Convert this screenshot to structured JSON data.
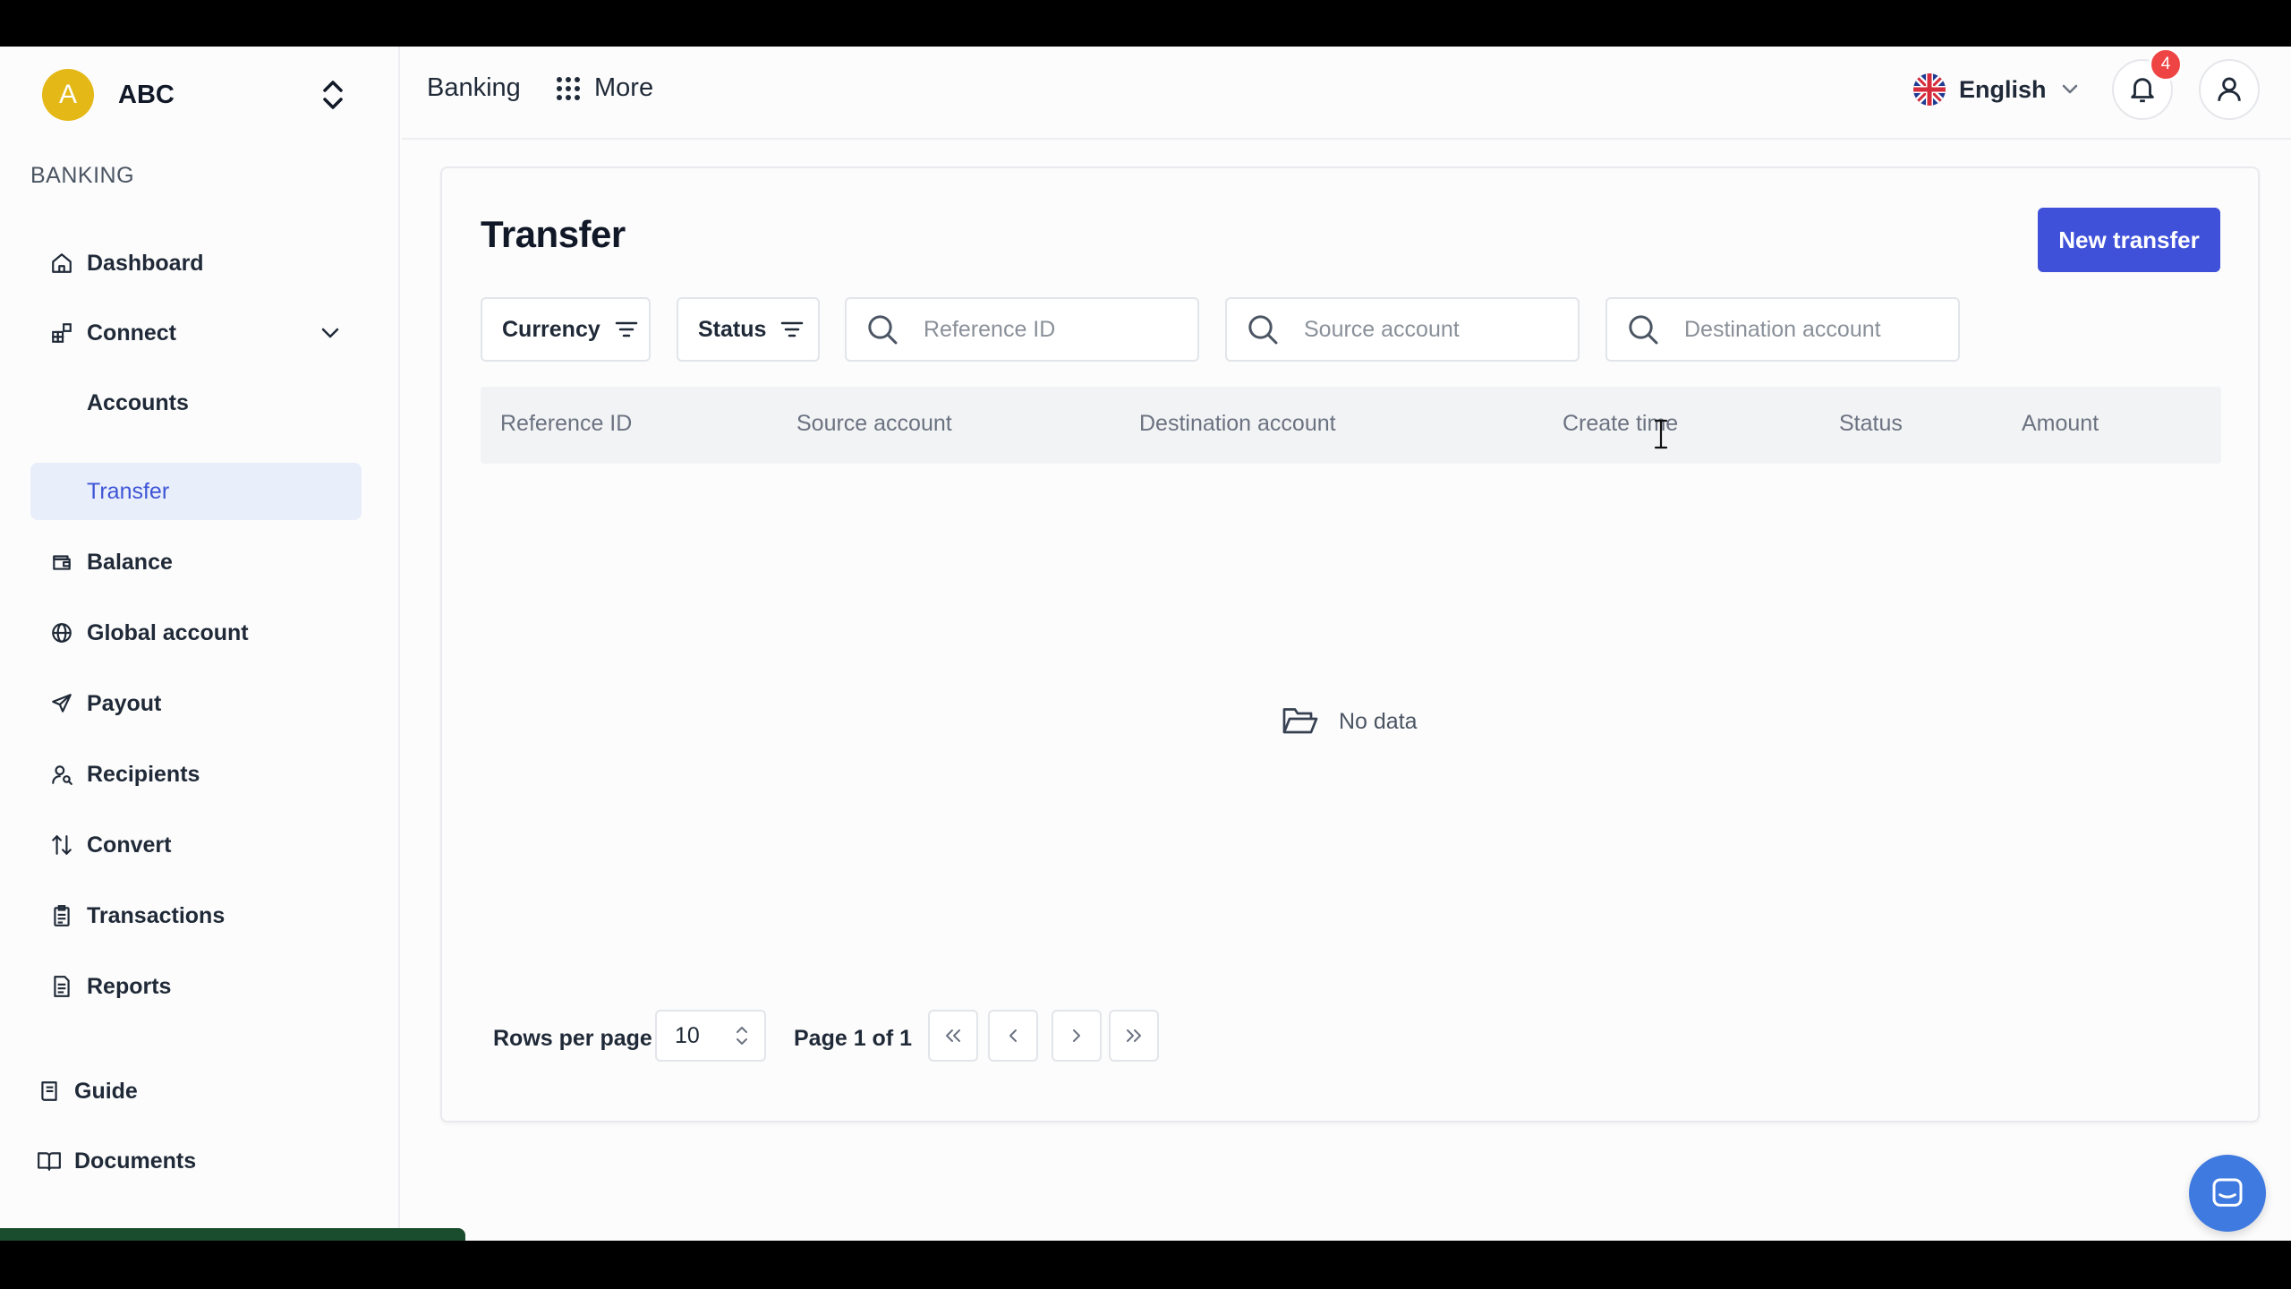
{
  "org": {
    "initial": "A",
    "name": "ABC"
  },
  "sidebar": {
    "section": "BANKING",
    "items": [
      {
        "label": "Dashboard"
      },
      {
        "label": "Connect"
      },
      {
        "label": "Accounts"
      },
      {
        "label": "Transfer"
      },
      {
        "label": "Balance"
      },
      {
        "label": "Global account"
      },
      {
        "label": "Payout"
      },
      {
        "label": "Recipients"
      },
      {
        "label": "Convert"
      },
      {
        "label": "Transactions"
      },
      {
        "label": "Reports"
      }
    ],
    "bottom": [
      {
        "label": "Guide"
      },
      {
        "label": "Documents"
      }
    ]
  },
  "topbar": {
    "banking": "Banking",
    "more": "More",
    "language": "English",
    "notification_count": "4"
  },
  "page": {
    "title": "Transfer",
    "new_button": "New transfer",
    "filters": {
      "currency": "Currency",
      "status": "Status"
    },
    "search": {
      "reference": "Reference ID",
      "source": "Source account",
      "destination": "Destination account"
    },
    "columns": [
      "Reference ID",
      "Source account",
      "Destination account",
      "Create time",
      "Status",
      "Amount"
    ],
    "empty": "No data",
    "pagination": {
      "rows_label": "Rows per page",
      "rows_value": "10",
      "page_info": "Page 1 of 1"
    }
  },
  "colors": {
    "accent": "#3f51d9",
    "active_bg": "#e9eefb",
    "avatar": "#e4b816",
    "badge": "#ef4444"
  }
}
